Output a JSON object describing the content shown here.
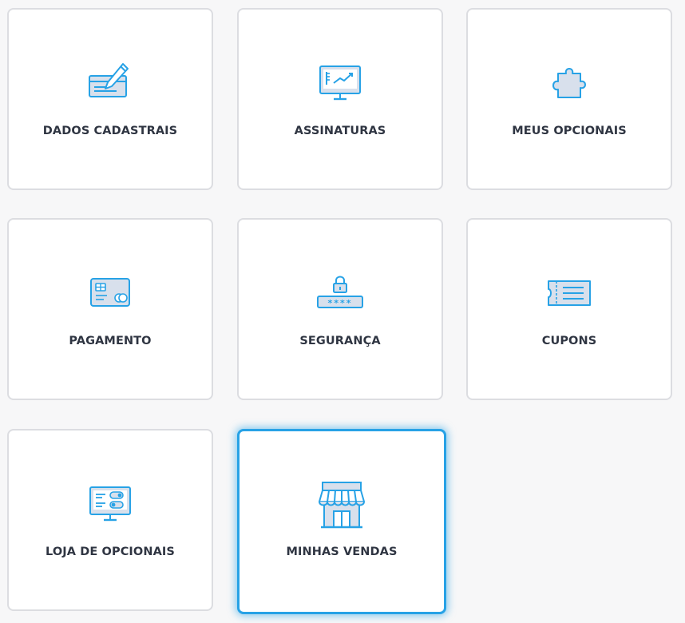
{
  "colors": {
    "accent": "#27a2e6",
    "icon_fill": "#d8e0ec",
    "label": "#2f3542",
    "card_border": "#dcdde1",
    "background": "#f7f7f8"
  },
  "cards": [
    {
      "label": "DADOS CADASTRAIS",
      "icon": "check-pen-icon",
      "active": false
    },
    {
      "label": "ASSINATURAS",
      "icon": "monitor-chart-icon",
      "active": false
    },
    {
      "label": "MEUS OPCIONAIS",
      "icon": "puzzle-piece-icon",
      "active": false
    },
    {
      "label": "PAGAMENTO",
      "icon": "credit-card-icon",
      "active": false
    },
    {
      "label": "SEGURANÇA",
      "icon": "password-lock-icon",
      "active": false
    },
    {
      "label": "CUPONS",
      "icon": "coupon-ticket-icon",
      "active": false
    },
    {
      "label": "LOJA DE OPCIONAIS",
      "icon": "monitor-toggles-icon",
      "active": false
    },
    {
      "label": "MINHAS VENDAS",
      "icon": "storefront-icon",
      "active": true
    }
  ]
}
